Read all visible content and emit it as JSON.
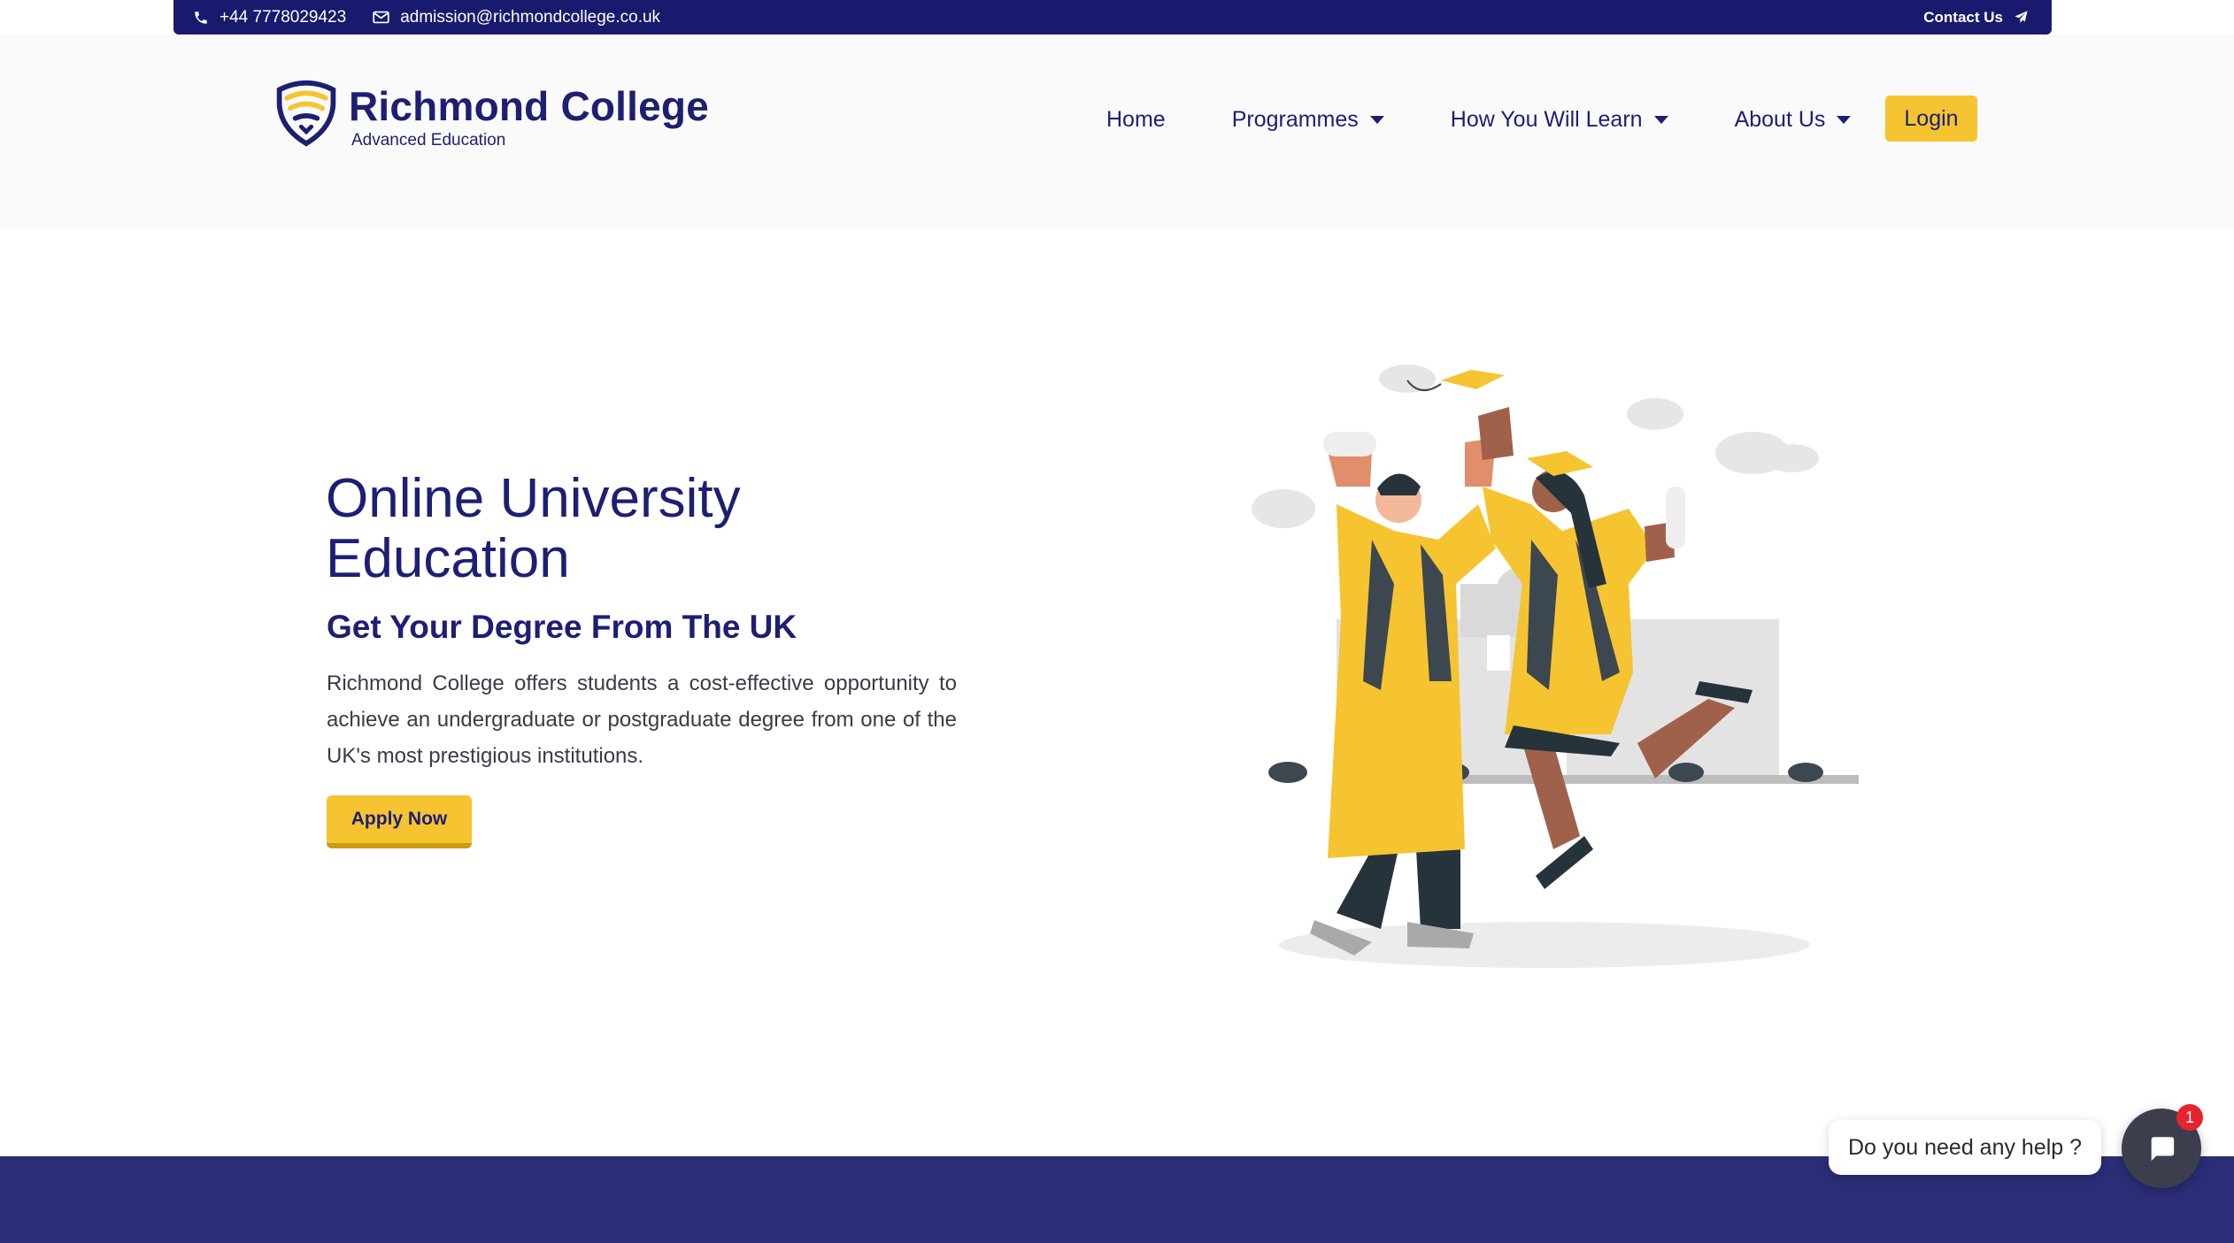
{
  "topbar": {
    "phone": "+44 7778029423",
    "email": "admission@richmondcollege.co.uk",
    "contact_label": "Contact Us",
    "background": "#191a6e"
  },
  "brand": {
    "name": "Richmond College",
    "tagline": "Advanced Education",
    "primary_color": "#1c1f73",
    "accent_color": "#f5c430"
  },
  "nav": {
    "items": [
      {
        "label": "Home",
        "has_dropdown": false
      },
      {
        "label": "Programmes",
        "has_dropdown": true
      },
      {
        "label": "How You Will Learn",
        "has_dropdown": true
      },
      {
        "label": "About Us",
        "has_dropdown": true
      }
    ],
    "login_label": "Login"
  },
  "hero": {
    "title_line1": "Online University",
    "title_line2": "Education",
    "subtitle": "Get Your Degree From The UK",
    "description": "Richmond College offers students a cost-effective opportunity to achieve an undergraduate or postgraduate degree from one of the UK's most prestigious institutions.",
    "cta_label": "Apply Now",
    "illustration_icon": "graduates-celebrating-illustration"
  },
  "chat": {
    "help_text": "Do you need any help ?",
    "badge_count": "1",
    "icon": "chat-bubble-icon"
  },
  "footer_band_color": "#2b2d77"
}
